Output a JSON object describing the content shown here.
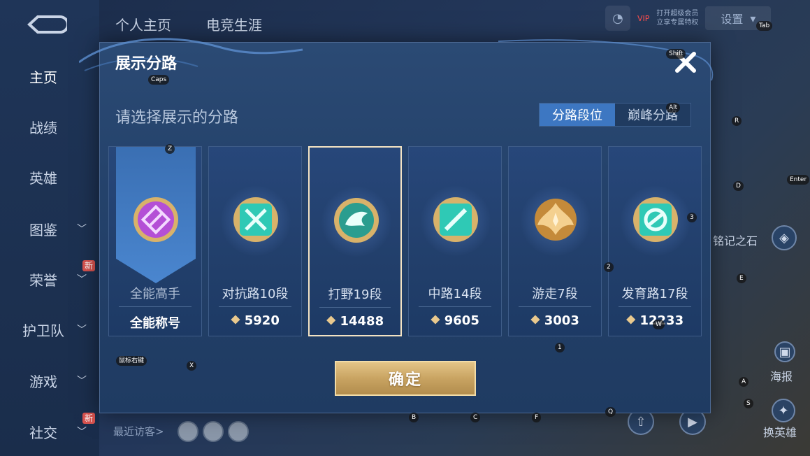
{
  "background": {
    "sidebar": {
      "items": [
        {
          "label": "主页",
          "active": true,
          "chevron": false,
          "badge": ""
        },
        {
          "label": "战绩",
          "active": false,
          "chevron": false,
          "badge": ""
        },
        {
          "label": "英雄",
          "active": false,
          "chevron": false,
          "badge": ""
        },
        {
          "label": "图鉴",
          "active": false,
          "chevron": true,
          "badge": ""
        },
        {
          "label": "荣誉",
          "active": false,
          "chevron": true,
          "badge": "新"
        },
        {
          "label": "护卫队",
          "active": false,
          "chevron": true,
          "badge": ""
        },
        {
          "label": "游戏",
          "active": false,
          "chevron": true,
          "badge": ""
        },
        {
          "label": "社交",
          "active": false,
          "chevron": true,
          "badge": "新"
        }
      ]
    },
    "tabs": [
      "个人主页",
      "电竞生涯"
    ],
    "top_right": {
      "vip": "VIP",
      "promo_line1": "打开超级会员",
      "promo_line2": "立享专属特权",
      "button_label": "设置"
    },
    "visitors_label": "最近访客>",
    "right_labels": {
      "stone": "铭记之石",
      "poster": "海报",
      "swap_hero": "换英雄"
    }
  },
  "key_hints": {
    "caps": "Caps",
    "shift": "Shift",
    "alt": "Alt",
    "tab": "Tab",
    "enter": "Enter",
    "z": "Z",
    "x": "X",
    "r": "R",
    "d": "D",
    "e": "E",
    "a": "A",
    "s": "S",
    "b": "B",
    "c": "C",
    "f": "F",
    "q": "Q",
    "w": "W",
    "n1": "1",
    "n2": "2",
    "n3": "3",
    "mouse": "鼠标右键"
  },
  "modal": {
    "title": "展示分路",
    "subtitle": "请选择展示的分路",
    "segment": {
      "options": [
        "分路段位",
        "巅峰分路"
      ],
      "active_index": 0
    },
    "confirm_label": "确定",
    "cards": [
      {
        "name": "全能高手",
        "value": "全能称号",
        "emblem": "allround-emblem-icon",
        "color": "#b44fd6",
        "selected": false
      },
      {
        "name": "对抗路10段",
        "value": "5920",
        "emblem": "clash-lane-emblem-icon",
        "color": "#2fc9b5",
        "selected": false
      },
      {
        "name": "打野19段",
        "value": "14488",
        "emblem": "jungle-emblem-icon",
        "color": "#2fb6a3",
        "selected": true
      },
      {
        "name": "中路14段",
        "value": "9605",
        "emblem": "mid-lane-emblem-icon",
        "color": "#2fc9b5",
        "selected": false
      },
      {
        "name": "游走7段",
        "value": "3003",
        "emblem": "roam-emblem-icon",
        "color": "#e0a24a",
        "selected": false
      },
      {
        "name": "发育路17段",
        "value": "12233",
        "emblem": "farm-lane-emblem-icon",
        "color": "#2fc9b5",
        "selected": false
      }
    ]
  }
}
